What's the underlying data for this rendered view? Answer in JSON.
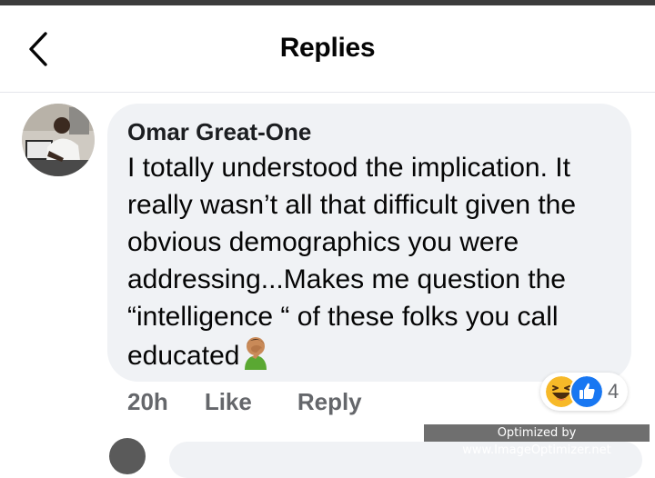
{
  "header": {
    "title": "Replies",
    "back_icon": "chevron-left-icon"
  },
  "comment": {
    "author": "Omar Great-One",
    "text": "I totally understood the implication. It really wasn’t all that difficult given the obvious demographics you were addressing...Makes me question the “intelligence “ of these folks you call educated",
    "inline_emoji": "facepalm-emoji",
    "timestamp": "20h",
    "like_label": "Like",
    "reply_label": "Reply",
    "reactions": {
      "icons": [
        "haha-reaction-icon",
        "like-reaction-icon"
      ],
      "count": "4"
    }
  },
  "watermark": {
    "text": "Optimized by www.ImageOptimizer.net"
  },
  "colors": {
    "bubble": "#f0f2f5",
    "secondary_text": "#65676b",
    "like_blue": "#1877f2",
    "haha_yellow": "#f7b928"
  }
}
